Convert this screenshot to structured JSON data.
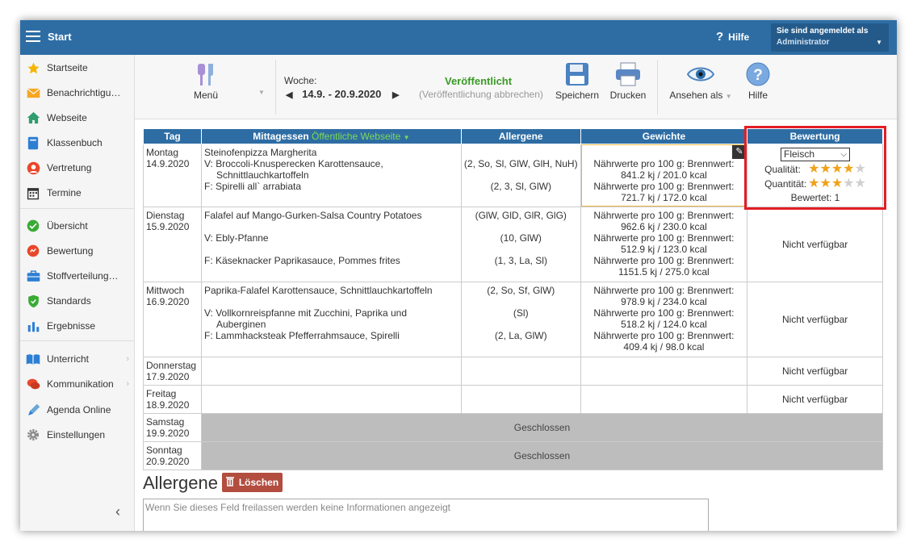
{
  "topbar": {
    "title": "Start",
    "help": "Hilfe",
    "user_line1": "Sie sind angemeldet als",
    "user_line2": "Administrator"
  },
  "sidebar": {
    "items": [
      {
        "label": "Startseite",
        "icon": "star-icon"
      },
      {
        "label": "Benachrichtigungen",
        "icon": "envelope-icon"
      },
      {
        "label": "Webseite",
        "icon": "house-icon"
      },
      {
        "label": "Klassenbuch",
        "icon": "book-icon"
      },
      {
        "label": "Vertretung",
        "icon": "person-icon"
      },
      {
        "label": "Termine",
        "icon": "calendar-icon"
      },
      {
        "label": "Übersicht",
        "icon": "check-circle-icon"
      },
      {
        "label": "Bewertung",
        "icon": "rating-icon"
      },
      {
        "label": "Stoffverteilungsplan",
        "icon": "briefcase-icon"
      },
      {
        "label": "Standards",
        "icon": "shield-icon"
      },
      {
        "label": "Ergebnisse",
        "icon": "bar-chart-icon"
      },
      {
        "label": "Unterricht",
        "icon": "open-book-icon"
      },
      {
        "label": "Kommunikation",
        "icon": "chat-icon"
      },
      {
        "label": "Agenda Online",
        "icon": "pen-icon"
      },
      {
        "label": "Einstellungen",
        "icon": "gear-icon"
      }
    ]
  },
  "toolbar": {
    "menu": "Menü",
    "week_label": "Woche:",
    "week_range": "14.9. - 20.9.2020",
    "status": "Veröffentlicht",
    "cancel": "(Veröffentlichung abbrechen)",
    "save": "Speichern",
    "print": "Drucken",
    "view_as": "Ansehen als",
    "help": "Hilfe"
  },
  "table": {
    "headers": {
      "day": "Tag",
      "meal": "Mittagessen",
      "meal_sub": "Öffentliche Webseite",
      "allergens": "Allergene",
      "weights": "Gewichte",
      "rating": "Bewertung"
    },
    "rows": [
      {
        "day": "Montag",
        "date": "14.9.2020",
        "meals": [
          "Steinofenpizza Margherita",
          "V: Broccoli-Knusperecken Karottensauce,",
          "Schnittlauchkartoffeln",
          "F: Spirelli all` arrabiata"
        ],
        "allergens": [
          "(2, So, Sl, GlW, GlH, NuH)",
          "(2, 3, Sl, GlW)"
        ],
        "weights": [
          "Nährwerte pro 100 g: Brennwert:",
          "841.2 kj / 201.0 kcal",
          "Nährwerte pro 100 g: Brennwert:",
          "721.7 kj / 172.0 kcal"
        ]
      },
      {
        "day": "Dienstag",
        "date": "15.9.2020",
        "meals": [
          "Falafel auf Mango-Gurken-Salsa Country Potatoes",
          "V: Ebly-Pfanne",
          "F: Käseknacker Paprikasauce, Pommes frites"
        ],
        "allergens": [
          "(GlW, GlD, GlR, GlG)",
          "(10, GlW)",
          "(1, 3, La, Sl)"
        ],
        "weights": [
          "Nährwerte pro 100 g: Brennwert:",
          "962.6 kj / 230.0 kcal",
          "Nährwerte pro 100 g: Brennwert:",
          "512.9 kj / 123.0 kcal",
          "Nährwerte pro 100 g: Brennwert:",
          "1151.5 kj / 275.0 kcal"
        ],
        "rating": "Nicht verfügbar"
      },
      {
        "day": "Mittwoch",
        "date": "16.9.2020",
        "meals": [
          "Paprika-Falafel Karottensauce, Schnittlauchkartoffeln",
          "V: Vollkornreispfanne mit Zucchini, Paprika und",
          "Auberginen",
          "F: Lammhacksteak Pfefferrahmsauce, Spirelli"
        ],
        "allergens": [
          "(2, So, Sf, GlW)",
          "(Sl)",
          "(2, La, GlW)"
        ],
        "weights": [
          "Nährwerte pro 100 g: Brennwert:",
          "978.9 kj / 234.0 kcal",
          "Nährwerte pro 100 g: Brennwert:",
          "518.2 kj / 124.0 kcal",
          "Nährwerte pro 100 g: Brennwert:",
          "409.4 kj / 98.0 kcal"
        ],
        "rating": "Nicht verfügbar"
      },
      {
        "day": "Donnerstag",
        "date": "17.9.2020",
        "rating": "Nicht verfügbar"
      },
      {
        "day": "Freitag",
        "date": "18.9.2020",
        "rating": "Nicht verfügbar"
      },
      {
        "day": "Samstag",
        "date": "19.9.2020",
        "closed": "Geschlossen"
      },
      {
        "day": "Sonntag",
        "date": "20.9.2020",
        "closed": "Geschlossen"
      }
    ]
  },
  "rating": {
    "select_value": "Fleisch",
    "quality_label": "Qualität:",
    "quality_stars": 4,
    "quantity_label": "Quantität:",
    "quantity_stars": 3,
    "max_stars": 5,
    "rated": "Bewertet: 1"
  },
  "allergene": {
    "title": "Allergene",
    "delete": "Löschen",
    "placeholder": "Wenn Sie dieses Feld freilassen werden keine Informationen angezeigt"
  },
  "colors": {
    "header_blue": "#2e6da4",
    "published_green": "#3a9a26",
    "highlight_red": "#e31e24",
    "star_gold": "#f0a21a",
    "delete_red": "#b24d3f"
  }
}
